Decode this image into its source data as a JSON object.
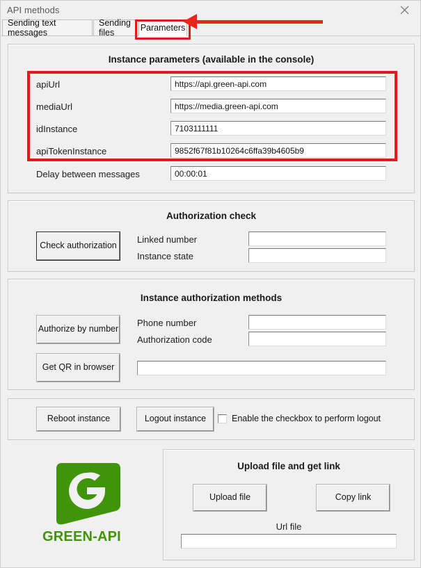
{
  "window": {
    "title": "API methods",
    "close_icon": "close-icon"
  },
  "tabs": [
    {
      "label": "Sending text messages",
      "active": false
    },
    {
      "label": "Sending files",
      "active": false
    },
    {
      "label": "Parameters",
      "active": true
    }
  ],
  "instance_parameters": {
    "title": "Instance parameters (available in the console)",
    "fields": [
      {
        "label": "apiUrl",
        "value": "https://api.green-api.com"
      },
      {
        "label": "mediaUrl",
        "value": "https://media.green-api.com"
      },
      {
        "label": "idInstance",
        "value": "7103111111"
      },
      {
        "label": "apiTokenInstance",
        "value": "9852f67f81b10264c6ffa39b4605b9"
      }
    ],
    "delay": {
      "label": "Delay between messages",
      "value": "00:00:01"
    }
  },
  "authorization_check": {
    "title": "Authorization check",
    "button": "Check authorization",
    "fields": [
      {
        "label": "Linked number",
        "value": ""
      },
      {
        "label": "Instance state",
        "value": ""
      }
    ]
  },
  "authorization_methods": {
    "title": "Instance authorization methods",
    "button_authorize": "Authorize by number",
    "button_qr": "Get QR in browser",
    "fields": [
      {
        "label": "Phone number",
        "value": ""
      },
      {
        "label": "Authorization code",
        "value": ""
      }
    ],
    "qr_field_value": ""
  },
  "instance_actions": {
    "button_reboot": "Reboot instance",
    "button_logout": "Logout instance",
    "checkbox_label": "Enable the checkbox to perform logout",
    "checkbox_checked": false
  },
  "upload": {
    "title": "Upload file and get link",
    "button_upload": "Upload file",
    "button_copy": "Copy link",
    "url_label": "Url file",
    "url_value": ""
  },
  "brand": {
    "name": "GREEN-API",
    "logo_letter": "G",
    "color": "#3f9409"
  },
  "annotations": {
    "highlight_color": "#e01b1b",
    "arrow_color": "#e8261c"
  }
}
